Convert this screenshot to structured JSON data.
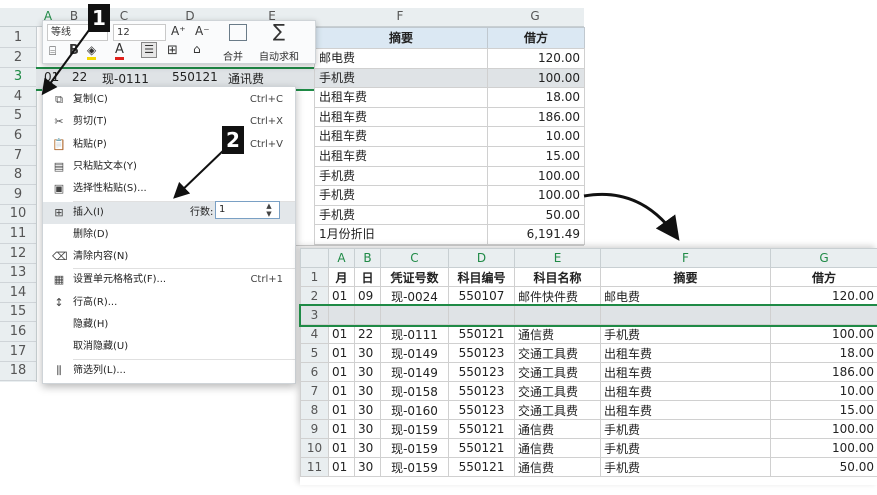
{
  "top_sheet": {
    "columns": [
      "A",
      "B",
      "C",
      "D",
      "E",
      "F",
      "G"
    ],
    "row_numbers": [
      "1",
      "2",
      "3",
      "4",
      "5",
      "6",
      "7",
      "8",
      "9",
      "10",
      "11",
      "12",
      "13",
      "14",
      "15",
      "16",
      "17",
      "18"
    ],
    "header_row": {
      "F": "摘要",
      "G": "借方"
    },
    "row3": {
      "A": "01",
      "B": "22",
      "C": "现-0111",
      "D": "550121",
      "E": "通讯费"
    },
    "rows": [
      {
        "F": "邮电费",
        "G": "120.00"
      },
      {
        "F": "手机费",
        "G": "100.00"
      },
      {
        "F": "出租车费",
        "G": "18.00"
      },
      {
        "F": "出租车费",
        "G": "186.00"
      },
      {
        "F": "出租车费",
        "G": "10.00"
      },
      {
        "F": "出租车费",
        "G": "15.00"
      },
      {
        "F": "手机费",
        "G": "100.00"
      },
      {
        "F": "手机费",
        "G": "100.00"
      },
      {
        "F": "手机费",
        "G": "50.00"
      },
      {
        "F": "1月份折旧",
        "G": "6,191.49"
      }
    ]
  },
  "toolbar": {
    "font_name": "等线",
    "font_size": "12",
    "grow_font": "A⁺",
    "shrink_font": "A⁻",
    "merge_label": "合并",
    "autosum_label": "自动求和",
    "bold": "B",
    "font_color": "A"
  },
  "context_menu": {
    "items": [
      {
        "label": "复制(C)",
        "shortcut": "Ctrl+C",
        "icon": "copy-icon"
      },
      {
        "label": "剪切(T)",
        "shortcut": "Ctrl+X",
        "icon": "cut-icon"
      },
      {
        "label": "粘贴(P)",
        "shortcut": "Ctrl+V",
        "icon": "paste-icon"
      },
      {
        "label": "只粘贴文本(Y)",
        "shortcut": "",
        "icon": "paste-text-icon"
      },
      {
        "label": "选择性粘贴(S)...",
        "shortcut": "",
        "icon": "paste-special-icon"
      },
      {
        "label": "插入(I)",
        "shortcut": "",
        "icon": "insert-icon"
      },
      {
        "label": "删除(D)",
        "shortcut": "",
        "icon": ""
      },
      {
        "label": "清除内容(N)",
        "shortcut": "",
        "icon": "clear-icon"
      },
      {
        "label": "设置单元格格式(F)...",
        "shortcut": "Ctrl+1",
        "icon": "format-cells-icon"
      },
      {
        "label": "行高(R)...",
        "shortcut": "",
        "icon": "row-height-icon"
      },
      {
        "label": "隐藏(H)",
        "shortcut": "",
        "icon": ""
      },
      {
        "label": "取消隐藏(U)",
        "shortcut": "",
        "icon": ""
      },
      {
        "label": "筛选列(L)...",
        "shortcut": "",
        "icon": "filter-columns-icon"
      }
    ],
    "rows_label": "行数:",
    "rows_value": "1"
  },
  "step_badges": [
    "1",
    "2"
  ],
  "bottom_sheet": {
    "columns": [
      "A",
      "B",
      "C",
      "D",
      "E",
      "F",
      "G"
    ],
    "headers": [
      "月",
      "日",
      "凭证号数",
      "科目编号",
      "科目名称",
      "摘要",
      "借方"
    ],
    "rows": [
      {
        "n": "2",
        "A": "01",
        "B": "09",
        "C": "现-0024",
        "D": "550107",
        "E": "邮件快件费",
        "F": "邮电费",
        "G": "120.00"
      },
      {
        "n": "3",
        "A": "",
        "B": "",
        "C": "",
        "D": "",
        "E": "",
        "F": "",
        "G": ""
      },
      {
        "n": "4",
        "A": "01",
        "B": "22",
        "C": "现-0111",
        "D": "550121",
        "E": "通信费",
        "F": "手机费",
        "G": "100.00"
      },
      {
        "n": "5",
        "A": "01",
        "B": "30",
        "C": "现-0149",
        "D": "550123",
        "E": "交通工具费",
        "F": "出租车费",
        "G": "18.00"
      },
      {
        "n": "6",
        "A": "01",
        "B": "30",
        "C": "现-0149",
        "D": "550123",
        "E": "交通工具费",
        "F": "出租车费",
        "G": "186.00"
      },
      {
        "n": "7",
        "A": "01",
        "B": "30",
        "C": "现-0158",
        "D": "550123",
        "E": "交通工具费",
        "F": "出租车费",
        "G": "10.00"
      },
      {
        "n": "8",
        "A": "01",
        "B": "30",
        "C": "现-0160",
        "D": "550123",
        "E": "交通工具费",
        "F": "出租车费",
        "G": "15.00"
      },
      {
        "n": "9",
        "A": "01",
        "B": "30",
        "C": "现-0159",
        "D": "550121",
        "E": "通信费",
        "F": "手机费",
        "G": "100.00"
      },
      {
        "n": "10",
        "A": "01",
        "B": "30",
        "C": "现-0159",
        "D": "550121",
        "E": "通信费",
        "F": "手机费",
        "G": "100.00"
      },
      {
        "n": "11",
        "A": "01",
        "B": "30",
        "C": "现-0159",
        "D": "550121",
        "E": "通信费",
        "F": "手机费",
        "G": "50.00"
      }
    ]
  },
  "colors": {
    "accent_green": "#1f8a46",
    "header_bg": "#e9eef0",
    "selection": "#dfe3e6"
  }
}
